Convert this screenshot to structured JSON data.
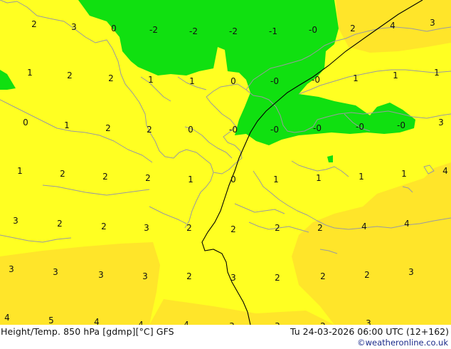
{
  "footer": {
    "title": "Height/Temp. 850 hPa [gdmp][°C] GFS",
    "datetime": "Tu 24-03-2026 06:00 UTC (12+162)",
    "copyright": "©weatheronline.co.uk"
  },
  "scale": {
    "ticks": [
      "-54",
      "-48",
      "-42",
      "-38",
      "-30",
      "-24",
      "-18",
      "-12",
      "-8",
      "0",
      "8",
      "12",
      "18",
      "24",
      "30",
      "36",
      "42",
      "48",
      "54"
    ],
    "colors": [
      "#888888",
      "#a050a0",
      "#d040d0",
      "#ff60ff",
      "#8000ff",
      "#0000ff",
      "#0080ff",
      "#00c0ff",
      "#008000",
      "#00c000",
      "#00ff00",
      "#ffff00",
      "#ffc800",
      "#ff9600",
      "#ff6400",
      "#ff0000",
      "#c00000",
      "#800000"
    ]
  },
  "legend_colors": {
    "green_band": "#10e010",
    "yellow_band": "#ffff22",
    "yellow_warm": "#ffe52a",
    "coast": "#9a9aa0",
    "isotherm": "#000000"
  },
  "map_labels": [
    {
      "text": "2"
    },
    {
      "text": "3"
    },
    {
      "text": "0"
    },
    {
      "text": "-2"
    },
    {
      "text": "-2"
    },
    {
      "text": "-2"
    },
    {
      "text": "-1"
    },
    {
      "text": "-0"
    },
    {
      "text": "2"
    },
    {
      "text": "4"
    },
    {
      "text": "3"
    },
    {
      "text": "1"
    },
    {
      "text": "2"
    },
    {
      "text": "2"
    },
    {
      "text": "1"
    },
    {
      "text": "1"
    },
    {
      "text": "0"
    },
    {
      "text": "-0"
    },
    {
      "text": "-0"
    },
    {
      "text": "1"
    },
    {
      "text": "1"
    },
    {
      "text": "1"
    },
    {
      "text": "0"
    },
    {
      "text": "1"
    },
    {
      "text": "2"
    },
    {
      "text": "2"
    },
    {
      "text": "0"
    },
    {
      "text": "-0"
    },
    {
      "text": "-0"
    },
    {
      "text": "-0"
    },
    {
      "text": "-0"
    },
    {
      "text": "-0"
    },
    {
      "text": "3"
    },
    {
      "text": "1"
    },
    {
      "text": "2"
    },
    {
      "text": "2"
    },
    {
      "text": "2"
    },
    {
      "text": "1"
    },
    {
      "text": "0"
    },
    {
      "text": "1"
    },
    {
      "text": "1"
    },
    {
      "text": "1"
    },
    {
      "text": "1"
    },
    {
      "text": "4"
    },
    {
      "text": "3"
    },
    {
      "text": "2"
    },
    {
      "text": "2"
    },
    {
      "text": "3"
    },
    {
      "text": "2"
    },
    {
      "text": "2"
    },
    {
      "text": "2"
    },
    {
      "text": "2"
    },
    {
      "text": "4"
    },
    {
      "text": "4"
    },
    {
      "text": "3"
    },
    {
      "text": "3"
    },
    {
      "text": "3"
    },
    {
      "text": "3"
    },
    {
      "text": "2"
    },
    {
      "text": "3"
    },
    {
      "text": "2"
    },
    {
      "text": "2"
    },
    {
      "text": "2"
    },
    {
      "text": "3"
    },
    {
      "text": "4"
    },
    {
      "text": "5"
    },
    {
      "text": "4"
    },
    {
      "text": "4"
    },
    {
      "text": "4"
    },
    {
      "text": "3"
    },
    {
      "text": "3"
    },
    {
      "text": "2"
    },
    {
      "text": "3"
    }
  ]
}
